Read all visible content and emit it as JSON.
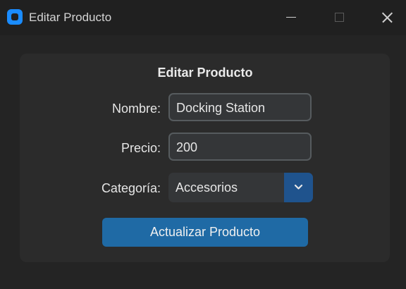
{
  "window": {
    "title": "Editar Producto",
    "icon": "app-logo-icon",
    "controls": [
      "minimize-icon",
      "maximize-icon",
      "close-icon"
    ]
  },
  "form": {
    "title": "Editar Producto",
    "fields": {
      "nombre": {
        "label": "Nombre:",
        "value": "Docking Station"
      },
      "precio": {
        "label": "Precio:",
        "value": "200"
      },
      "categoria": {
        "label": "Categoría:",
        "selected": "Accesorios",
        "icon": "chevron-down-icon"
      }
    },
    "submit_label": "Actualizar Producto"
  },
  "colors": {
    "background": "#242424",
    "frame": "#2b2b2b",
    "input_bg": "#343638",
    "input_border": "#565b5e",
    "accent": "#1f6aa5",
    "dropdown_button": "#1f538d",
    "app_icon": "#1a8cff"
  }
}
